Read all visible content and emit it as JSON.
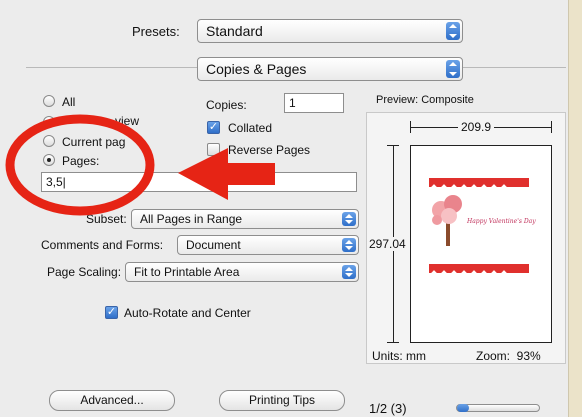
{
  "presets": {
    "label": "Presets:",
    "value": "Standard"
  },
  "section_popup": {
    "value": "Copies & Pages"
  },
  "pages_group": {
    "all_label": "All",
    "selection_label": "view",
    "current_page_label": "Current pag",
    "pages_label": "Pages:",
    "pages_value": "3,5|",
    "selected": "pages"
  },
  "copies": {
    "label": "Copies:",
    "value": "1"
  },
  "collated": {
    "label": "Collated",
    "checked": true
  },
  "reverse_pages": {
    "label": "Reverse Pages",
    "checked": false
  },
  "subset": {
    "label": "Subset:",
    "value": "All Pages in Range"
  },
  "comments_forms": {
    "label": "Comments and Forms:",
    "value": "Document"
  },
  "page_scaling": {
    "label": "Page Scaling:",
    "value": "Fit to Printable Area"
  },
  "auto_rotate": {
    "label": "Auto-Rotate and Center",
    "checked": true
  },
  "preview": {
    "title": "Preview: Composite",
    "width": "209.9",
    "height": "297.04",
    "units": "Units: mm",
    "zoom": "Zoom:  93%",
    "card_text": "Happy Valentine's Day"
  },
  "buttons": {
    "advanced": "Advanced...",
    "printing_tips": "Printing Tips"
  },
  "page_indicator": "1/2 (3)",
  "colors": {
    "annotation_red": "#e62415",
    "accent_blue": "#2f6fc9"
  }
}
